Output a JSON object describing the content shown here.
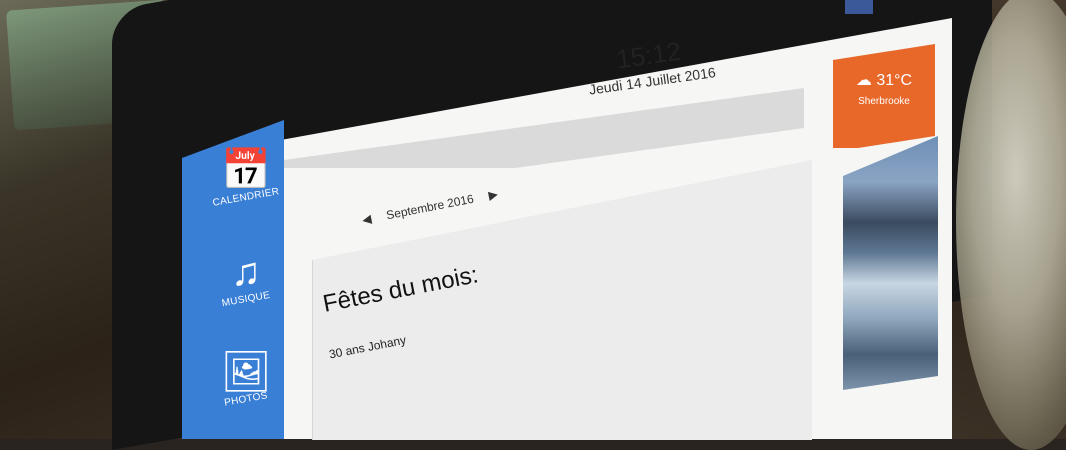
{
  "clock": {
    "time": "15:12",
    "date": "Jeudi 14 Juillet 2016"
  },
  "sidebar": {
    "items": [
      {
        "label": "CALENDRIER",
        "icon": "calendar-icon"
      },
      {
        "label": "MUSIQUE",
        "icon": "music-note-icon"
      },
      {
        "label": "PHOTOS",
        "icon": "photo-icon"
      }
    ]
  },
  "calendar": {
    "month_label": "Septembre 2016",
    "prev_icon": "arrow-left-icon",
    "next_icon": "arrow-right-icon",
    "section_title": "Fêtes du mois:",
    "entries": [
      {
        "name": "30 ans Johany"
      }
    ]
  },
  "weather": {
    "temp": "31°C",
    "city": "Sherbrooke",
    "icon": "weather-cloud-icon"
  },
  "colors": {
    "sidebar": "#3a7fd6",
    "weather": "#e8682a"
  }
}
